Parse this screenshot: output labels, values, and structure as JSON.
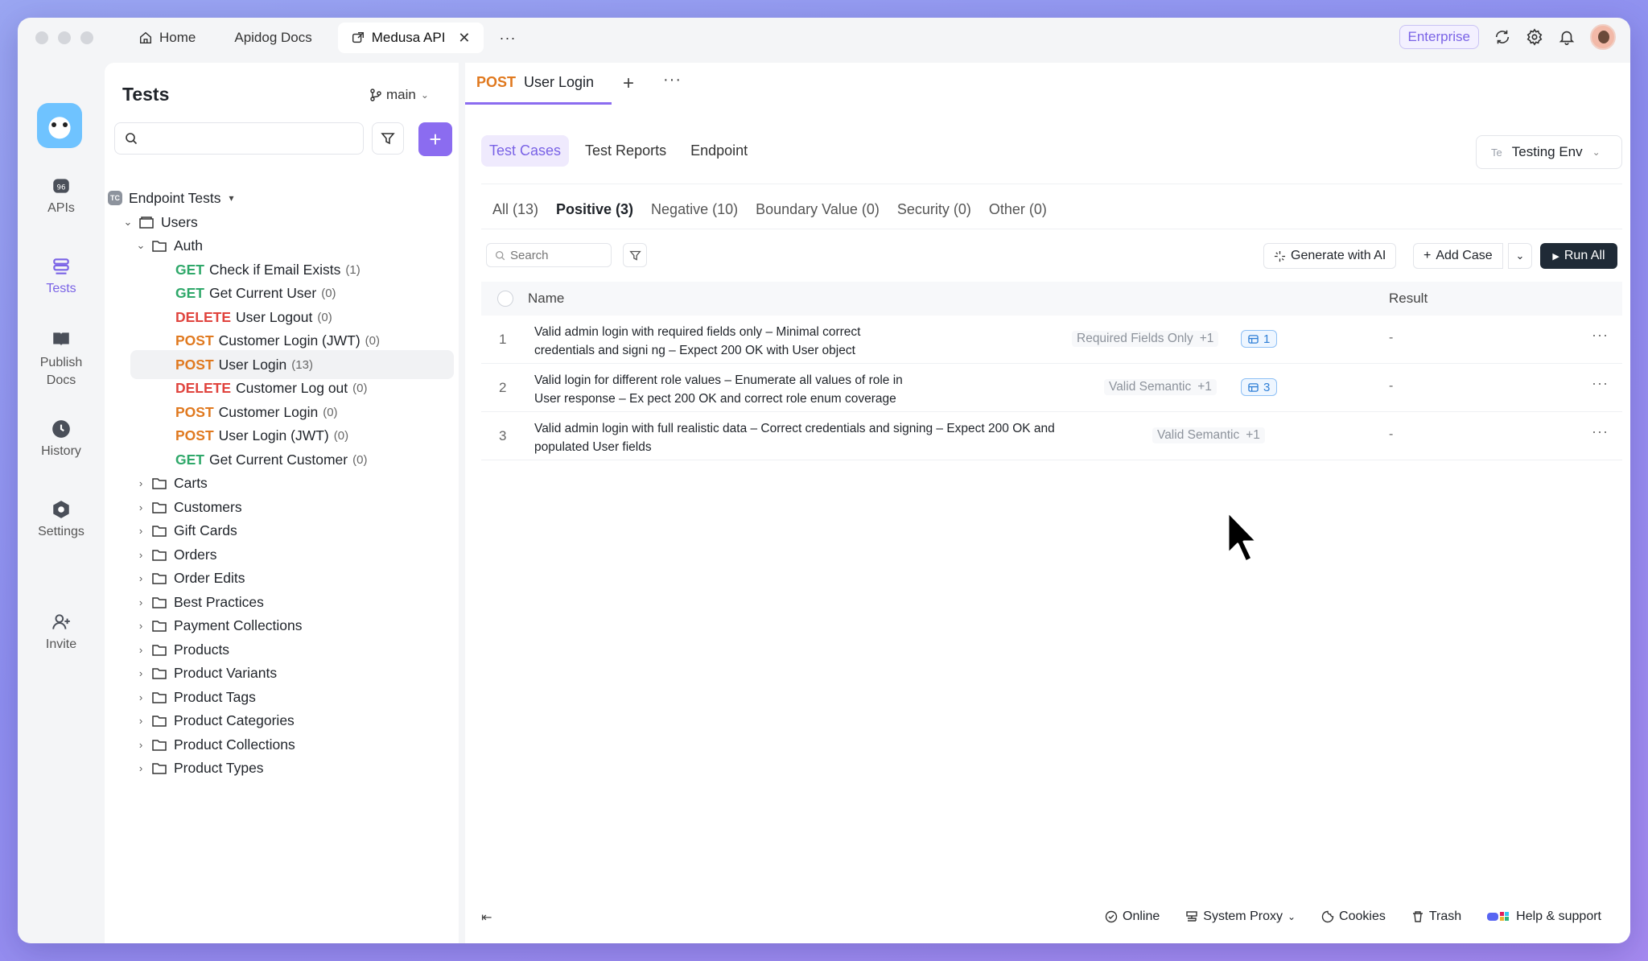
{
  "titlebar": {
    "tabs": [
      {
        "label": "Home",
        "icon": "home-icon"
      },
      {
        "label": "Apidog Docs",
        "icon": ""
      },
      {
        "label": "Medusa API",
        "icon": "external-link-icon",
        "active": true
      }
    ],
    "more": "···",
    "enterprise_label": "Enterprise"
  },
  "rail": {
    "items": [
      {
        "label": "APIs",
        "icon": "apis-icon"
      },
      {
        "label": "Tests",
        "icon": "tests-icon",
        "active": true
      },
      {
        "label": "Publish Docs",
        "icon": "book-icon"
      },
      {
        "label": "History",
        "icon": "clock-icon"
      },
      {
        "label": "Settings",
        "icon": "settings-icon"
      },
      {
        "label": "Invite",
        "icon": "invite-icon"
      }
    ]
  },
  "sidebar": {
    "title": "Tests",
    "branch": "main",
    "search_placeholder": "",
    "add_label": "+",
    "root": {
      "badge": "TC",
      "label": "Endpoint Tests",
      "caret": "▾"
    },
    "users": "Users",
    "auth": "Auth",
    "endpoints": [
      {
        "method": "GET",
        "name": "Check if Email Exists",
        "count": "(1)"
      },
      {
        "method": "GET",
        "name": "Get Current User",
        "count": "(0)"
      },
      {
        "method": "DELETE",
        "name": "User Logout",
        "count": "(0)"
      },
      {
        "method": "POST",
        "name": "Customer Login (JWT)",
        "count": "(0)"
      },
      {
        "method": "POST",
        "name": "User Login",
        "count": "(13)"
      },
      {
        "method": "DELETE",
        "name": "Customer Log out",
        "count": "(0)"
      },
      {
        "method": "POST",
        "name": "Customer Login",
        "count": "(0)"
      },
      {
        "method": "POST",
        "name": "User Login (JWT)",
        "count": "(0)"
      },
      {
        "method": "GET",
        "name": "Get Current Customer",
        "count": "(0)"
      }
    ],
    "folders": [
      "Carts",
      "Customers",
      "Gift Cards",
      "Orders",
      "Order Edits",
      "Best Practices",
      "Payment Collections",
      "Products",
      "Product Variants",
      "Product Tags",
      "Product Categories",
      "Product Collections",
      "Product Types"
    ]
  },
  "main": {
    "request_tab": {
      "method": "POST",
      "name": "User Login"
    },
    "add_tab": "+",
    "more_tab": "···",
    "subtabs": [
      "Test Cases",
      "Test Reports",
      "Endpoint"
    ],
    "env": {
      "prefix": "Te",
      "label": "Testing Env"
    },
    "categories": [
      "All (13)",
      "Positive (3)",
      "Negative (10)",
      "Boundary Value (0)",
      "Security (0)",
      "Other (0)"
    ],
    "search_placeholder": "Search",
    "generate_label": "Generate with AI",
    "add_case_label": "Add Case",
    "run_all_label": "Run All",
    "columns": {
      "name": "Name",
      "result": "Result"
    },
    "rows": [
      {
        "num": "1",
        "name": "Valid admin login with required fields only – Minimal correct credentials and signi ng – Expect 200 OK with User object",
        "tag": "Required Fields Only",
        "plus": "+1",
        "data": "1",
        "result": "-"
      },
      {
        "num": "2",
        "name": "Valid login for different role values – Enumerate all values of role in User response – Ex pect 200 OK and correct role enum coverage",
        "tag": "Valid Semantic",
        "plus": "+1",
        "data": "3",
        "result": "-"
      },
      {
        "num": "3",
        "name": "Valid admin login with full realistic data – Correct credentials and signing – Expect 200 OK and populated User fields",
        "tag": "Valid Semantic",
        "plus": "+1",
        "data": "",
        "result": "-"
      }
    ],
    "row_more": "···"
  },
  "footer": {
    "online": "Online",
    "proxy": "System Proxy",
    "cookies": "Cookies",
    "trash": "Trash",
    "help": "Help & support"
  },
  "colors": {
    "accent": "#8b6cf0",
    "get": "#2fa86a",
    "post": "#e0791f",
    "delete": "#e0443e",
    "run_all": "#1f2a36"
  }
}
